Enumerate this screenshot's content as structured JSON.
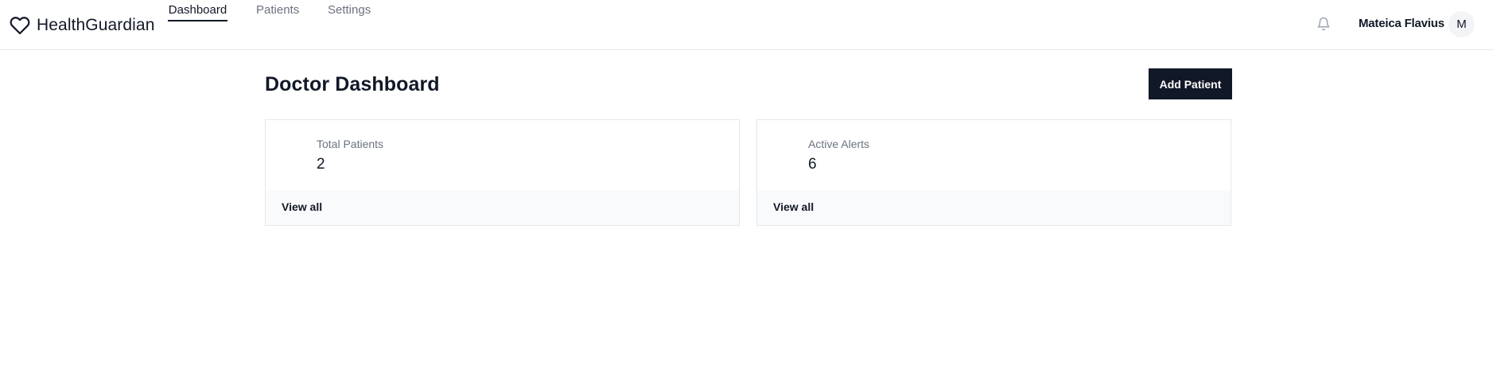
{
  "header": {
    "brand": "HealthGuardian",
    "brand_icon": "heart-icon",
    "tabs": [
      {
        "label": "Dashboard",
        "active": true
      },
      {
        "label": "Patients",
        "active": false
      },
      {
        "label": "Settings",
        "active": false
      }
    ],
    "notifications_icon": "bell-icon",
    "user_name": "Mateica Flavius",
    "avatar_initial": "M"
  },
  "main": {
    "title": "Doctor Dashboard",
    "add_button_label": "Add Patient",
    "cards": [
      {
        "label": "Total Patients",
        "value": "2",
        "link": "View all"
      },
      {
        "label": "Active Alerts",
        "value": "6",
        "link": "View all"
      }
    ]
  },
  "colors": {
    "primary": "#111827",
    "muted_text": "#6b7280",
    "border": "#e5e7eb",
    "card_footer_bg": "#f9fafb"
  }
}
